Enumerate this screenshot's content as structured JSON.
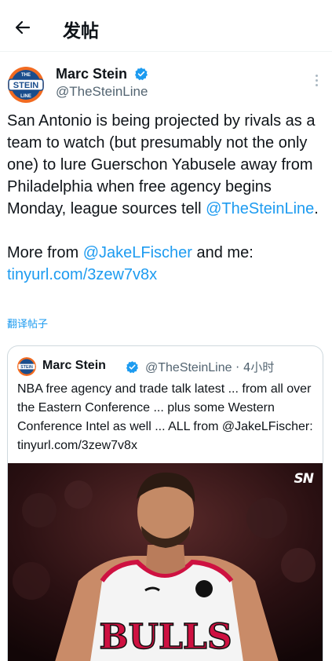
{
  "header": {
    "title": "发帖",
    "back_icon": "arrow-left-icon"
  },
  "tweet": {
    "author_name": "Marc Stein",
    "author_handle": "@TheSteinLine",
    "avatar_text_top": "THE",
    "avatar_text_mid": "STEIN",
    "avatar_text_bottom": "LINE",
    "verified_color": "#1d9bf0",
    "text_part1": "San Antonio is being projected by rivals as a team to watch (but presumably not the only one) to lure Guerschon Yabusele away from Philadelphia when free agency begins Monday, league sources tell ",
    "mention1": "@TheSteinLine",
    "text_part1_end": ".",
    "text_part2_start": "More from ",
    "mention2": "@JakeLFischer",
    "text_part2_mid": " and me:",
    "link": "tinyurl.com/3zew7v8x",
    "translate_label": "翻译帖子"
  },
  "quote": {
    "author_name": "Marc Stein",
    "author_handle": "@TheSteinLine",
    "time": " · 4小时",
    "text": "NBA free agency and trade talk latest ... from all over the Eastern Conference ... plus some Western Conference Intel as well ... ALL from @JakeLFischer: tinyurl.com/3zew7v8x",
    "image_logo": "SN",
    "jersey_text": "BULLS"
  },
  "colors": {
    "accent": "#1d9bf0",
    "secondary_text": "#536471",
    "bulls_red": "#ce1141"
  }
}
